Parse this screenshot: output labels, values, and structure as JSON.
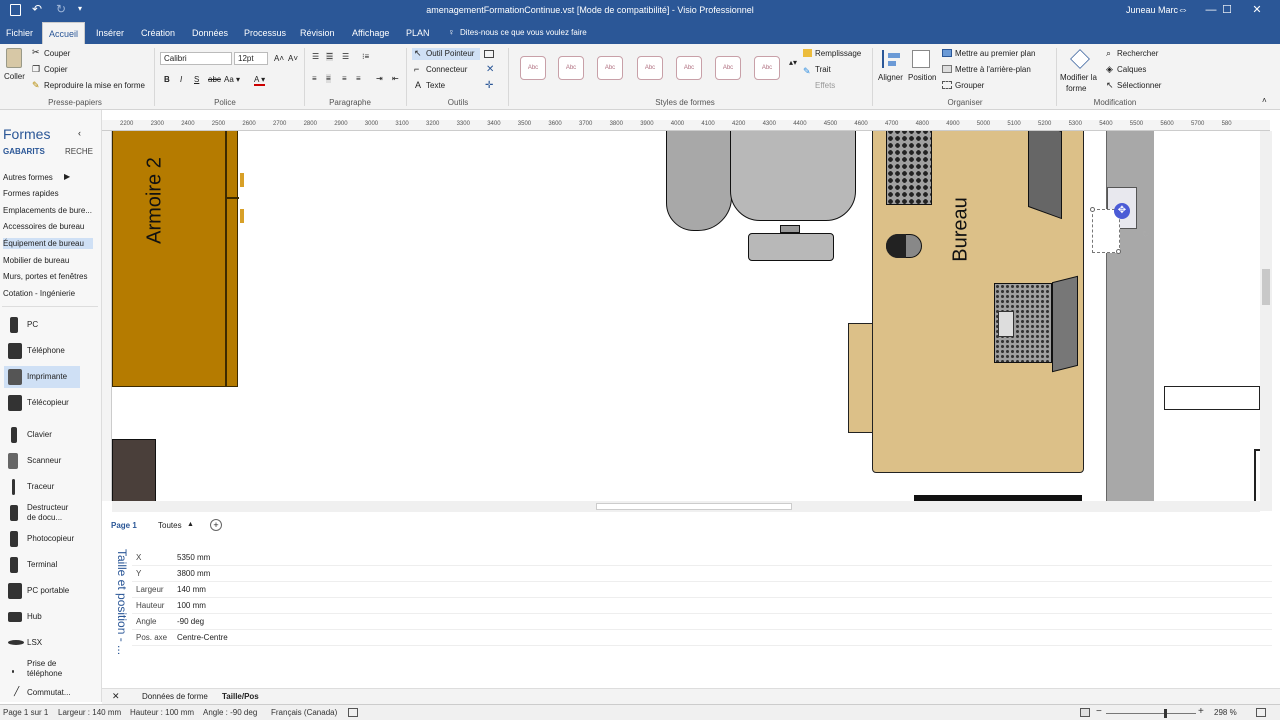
{
  "title_bar": {
    "title": "amenagementFormationContinue.vst  [Mode de compatibilité] - Visio Professionnel",
    "user": "Juneau Marc"
  },
  "tabs": [
    "Fichier",
    "Accueil",
    "Insérer",
    "Création",
    "Données",
    "Processus",
    "Révision",
    "Affichage",
    "PLAN"
  ],
  "tell_me": "Dites-nous ce que vous voulez faire",
  "ribbon": {
    "clipboard": {
      "paste": "Coller",
      "cut": "Couper",
      "copy": "Copier",
      "format_painter": "Reproduire la mise en forme",
      "label": "Presse-papiers"
    },
    "font": {
      "name": "Calibri",
      "size": "12pt",
      "label": "Police"
    },
    "paragraph": {
      "label": "Paragraphe"
    },
    "tools": {
      "pointer": "Outil Pointeur",
      "connector": "Connecteur",
      "text": "Texte",
      "label": "Outils"
    },
    "shape_styles": {
      "sample": "Abc",
      "label": "Styles de formes"
    },
    "fill": "Remplissage",
    "line": "Trait",
    "effects": "Effets",
    "arrange": {
      "align": "Aligner",
      "position": "Position",
      "front": "Mettre au premier plan",
      "back": "Mettre à l'arrière-plan",
      "group": "Grouper",
      "label": "Organiser"
    },
    "editing": {
      "change_shape_1": "Modifier la",
      "change_shape_2": "forme",
      "find": "Rechercher",
      "layers": "Calques",
      "select": "Sélectionner",
      "label": "Modification"
    }
  },
  "shapes_panel": {
    "title": "Formes",
    "tab_stencils": "GABARITS",
    "tab_search": "RECHE",
    "stencils": [
      "Autres formes",
      "Formes rapides",
      "Emplacements de bure...",
      "Accessoires de bureau",
      "Équipement de bureau",
      "Mobilier de bureau",
      "Murs, portes et fenêtres",
      "Cotation - Ingénierie"
    ],
    "masters": [
      "PC",
      "Téléphone",
      "Imprimante",
      "Télécopieur",
      "Clavier",
      "Scanneur",
      "Traceur",
      "Destructeur de docu...",
      "Photocopieur",
      "Terminal",
      "PC portable",
      "Hub",
      "LSX",
      "Prise de téléphone",
      "Commutat..."
    ]
  },
  "ruler": [
    "2200",
    "2300",
    "2400",
    "2500",
    "2600",
    "2700",
    "2800",
    "2900",
    "3000",
    "3100",
    "3200",
    "3300",
    "3400",
    "3500",
    "3600",
    "3700",
    "3800",
    "3900",
    "4000",
    "4100",
    "4200",
    "4300",
    "4400",
    "4500",
    "4600",
    "4700",
    "4800",
    "4900",
    "5000",
    "5100",
    "5200",
    "5300",
    "5400",
    "5500",
    "5600",
    "5700",
    "580"
  ],
  "canvas": {
    "armoire": "Armoire 2",
    "bureau": "Bureau"
  },
  "page_tabs": {
    "page": "Page 1",
    "all": "Toutes"
  },
  "properties": {
    "panel_title": "Taille et position - ...",
    "rows": [
      {
        "k": "X",
        "v": "5350 mm"
      },
      {
        "k": "Y",
        "v": "3800 mm"
      },
      {
        "k": "Largeur",
        "v": "140 mm"
      },
      {
        "k": "Hauteur",
        "v": "100 mm"
      },
      {
        "k": "Angle",
        "v": "-90 deg"
      },
      {
        "k": "Pos. axe",
        "v": "Centre-Centre"
      }
    ],
    "tab_shape_data": "Données de forme",
    "tab_size_pos": "Taille/Pos"
  },
  "status": {
    "page": "Page 1 sur 1",
    "width": "Largeur : 140 mm",
    "height": "Hauteur : 100 mm",
    "angle": "Angle : -90 deg",
    "language": "Français (Canada)",
    "zoom": "298 %"
  }
}
